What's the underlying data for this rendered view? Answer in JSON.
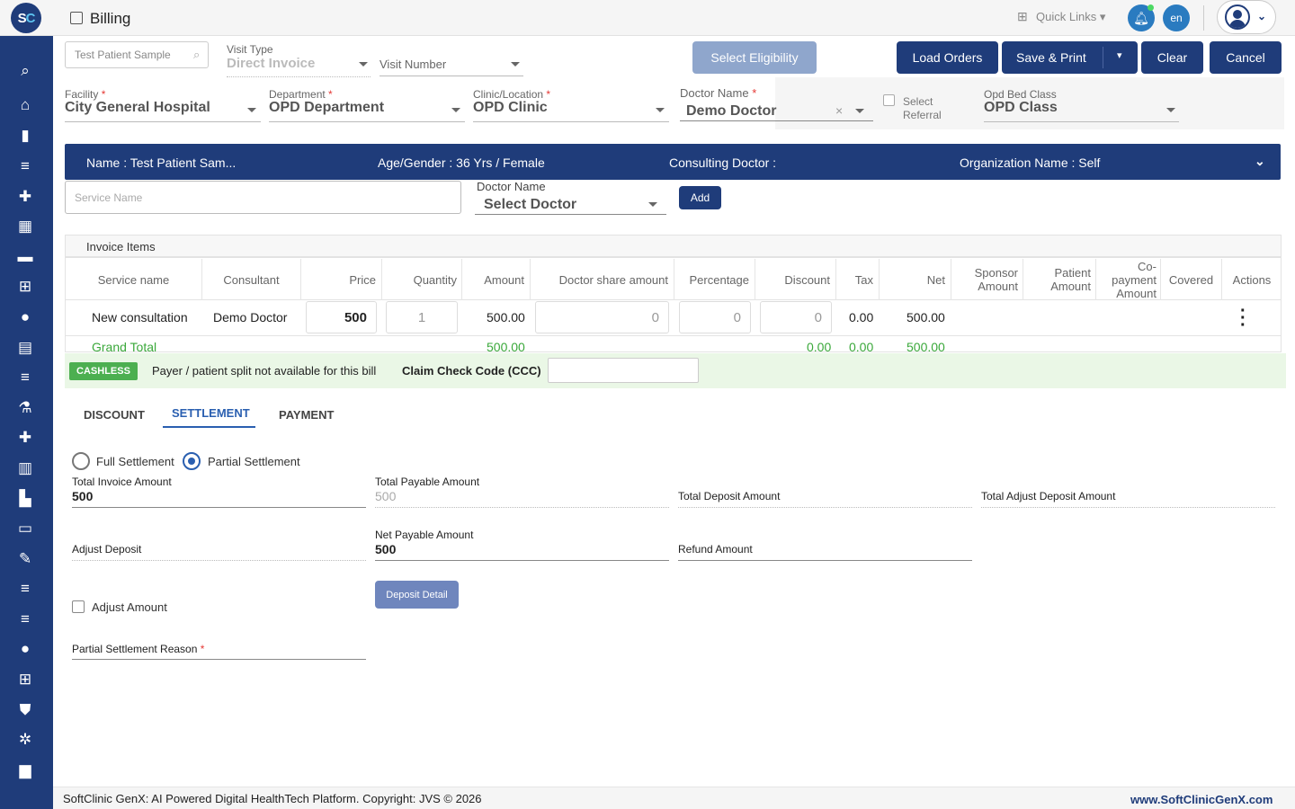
{
  "app": {
    "logo_left": "S",
    "logo_right": "C",
    "title": "Billing"
  },
  "header": {
    "quick_links": "Quick Links",
    "lang": "en"
  },
  "search_patient": {
    "placeholder": "Test Patient Sample"
  },
  "visit_type": {
    "label": "Visit Type",
    "value": "Direct Invoice"
  },
  "visit_number": {
    "label": "Visit Number"
  },
  "buttons": {
    "select_eligibility": "Select Eligibility",
    "load_orders": "Load Orders",
    "save_print": "Save & Print",
    "clear": "Clear",
    "cancel": "Cancel",
    "add": "Add",
    "deposit_detail": "Deposit Detail"
  },
  "facility": {
    "label": "Facility",
    "value": "City General Hospital"
  },
  "department": {
    "label": "Department",
    "value": "OPD Department"
  },
  "clinic": {
    "label": "Clinic/Location",
    "value": "OPD Clinic"
  },
  "doctor": {
    "label": "Doctor Name",
    "value": "Demo Doctor"
  },
  "referral": {
    "line1": "Select",
    "line2": "Referral"
  },
  "bed_class": {
    "label": "Opd Bed Class",
    "value": "OPD Class"
  },
  "patient": {
    "name": "Name :  Test Patient Sam...",
    "age_gender": "Age/Gender :  36 Yrs / Female",
    "consulting": "Consulting Doctor :",
    "org": "Organization Name :  Self"
  },
  "service": {
    "placeholder": "Service Name",
    "doctor_label": "Doctor Name",
    "doctor_value": "Select Doctor"
  },
  "invoice": {
    "title": "Invoice Items",
    "columns": [
      "Service name",
      "Consultant",
      "Price",
      "Quantity",
      "Amount",
      "Doctor share amount",
      "Percentage",
      "Discount",
      "Tax",
      "Net",
      "Sponsor Amount",
      "Patient Amount",
      "Co-payment Amount",
      "Covered",
      "Actions"
    ],
    "row": {
      "service": "New consultation",
      "consultant": "Demo Doctor",
      "price": "500",
      "quantity": "1",
      "amount": "500.00",
      "doctor_share": "0",
      "percentage": "0",
      "discount": "0",
      "tax": "0.00",
      "net": "500.00"
    },
    "grand_total": {
      "label": "Grand Total",
      "amount": "500.00",
      "discount": "0.00",
      "tax": "0.00",
      "net": "500.00"
    }
  },
  "cashless": {
    "badge": "CASHLESS",
    "message": "Payer / patient split not available for this bill",
    "ccc_label": "Claim Check Code (CCC)"
  },
  "tabs": [
    "DISCOUNT",
    "SETTLEMENT",
    "PAYMENT"
  ],
  "settlement": {
    "full": "Full Settlement",
    "partial": "Partial Settlement",
    "total_invoice_label": "Total Invoice Amount",
    "total_invoice_value": "500",
    "total_payable_label": "Total Payable Amount",
    "total_payable_value": "500",
    "total_deposit_label": "Total Deposit Amount",
    "total_adjust_label": "Total Adjust Deposit Amount",
    "adjust_deposit_label": "Adjust Deposit",
    "net_payable_label": "Net Payable Amount",
    "net_payable_value": "500",
    "refund_label": "Refund Amount",
    "adjust_amount_label": "Adjust Amount",
    "reason_label": "Partial Settlement Reason"
  },
  "footer": {
    "left": "SoftClinic GenX: AI Powered Digital HealthTech Platform. Copyright: JVS © 2026",
    "right": "www.SoftClinicGenX.com"
  },
  "colors": {
    "primary": "#1f3c7a",
    "accent": "#2a7bc0",
    "green": "#4caf50"
  }
}
